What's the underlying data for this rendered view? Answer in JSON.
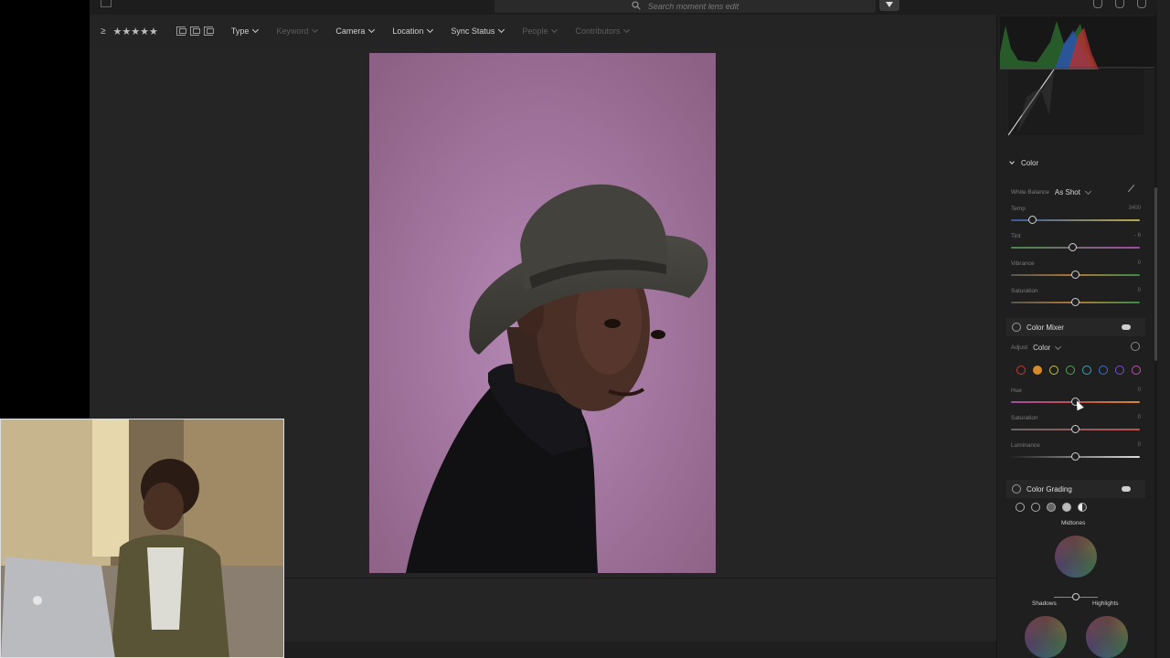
{
  "search": {
    "placeholder": "Search moment lens edit"
  },
  "filterbar": {
    "gte_symbol": "≥",
    "stars": "★★★★★",
    "items": [
      {
        "label": "Type",
        "enabled": true
      },
      {
        "label": "Keyword",
        "enabled": false
      },
      {
        "label": "Camera",
        "enabled": true
      },
      {
        "label": "Location",
        "enabled": true
      },
      {
        "label": "Sync Status",
        "enabled": true
      },
      {
        "label": "People",
        "enabled": false
      },
      {
        "label": "Contributors",
        "enabled": false
      }
    ]
  },
  "panel": {
    "color_section": "Color",
    "white_balance": {
      "label": "White Balance",
      "value": "As Shot"
    },
    "temp": {
      "label": "Temp",
      "value": "3400",
      "position": 0.17
    },
    "tint": {
      "label": "Tint",
      "value": "- 6",
      "position": 0.48
    },
    "vibrance": {
      "label": "Vibrance",
      "value": "0",
      "position": 0.5
    },
    "saturation": {
      "label": "Saturation",
      "value": "0",
      "position": 0.5
    },
    "color_mixer": {
      "title": "Color Mixer",
      "adjust_label": "Adjust",
      "adjust_value": "Color",
      "swatch_colors": [
        "#c23b3b",
        "#d78a2a",
        "#c9c23a",
        "#4faa4b",
        "#3aa5b8",
        "#3a6fd1",
        "#7a4fd1",
        "#c24fb5"
      ],
      "hue": {
        "label": "Hue",
        "value": "0",
        "position": 0.5
      },
      "saturation": {
        "label": "Saturation",
        "value": "0",
        "position": 0.5
      },
      "luminance": {
        "label": "Luminance",
        "value": "0",
        "position": 0.5
      }
    },
    "color_grading": {
      "title": "Color Grading",
      "midtones": "Midtones",
      "shadows": "Shadows",
      "highlights": "Highlights"
    }
  }
}
